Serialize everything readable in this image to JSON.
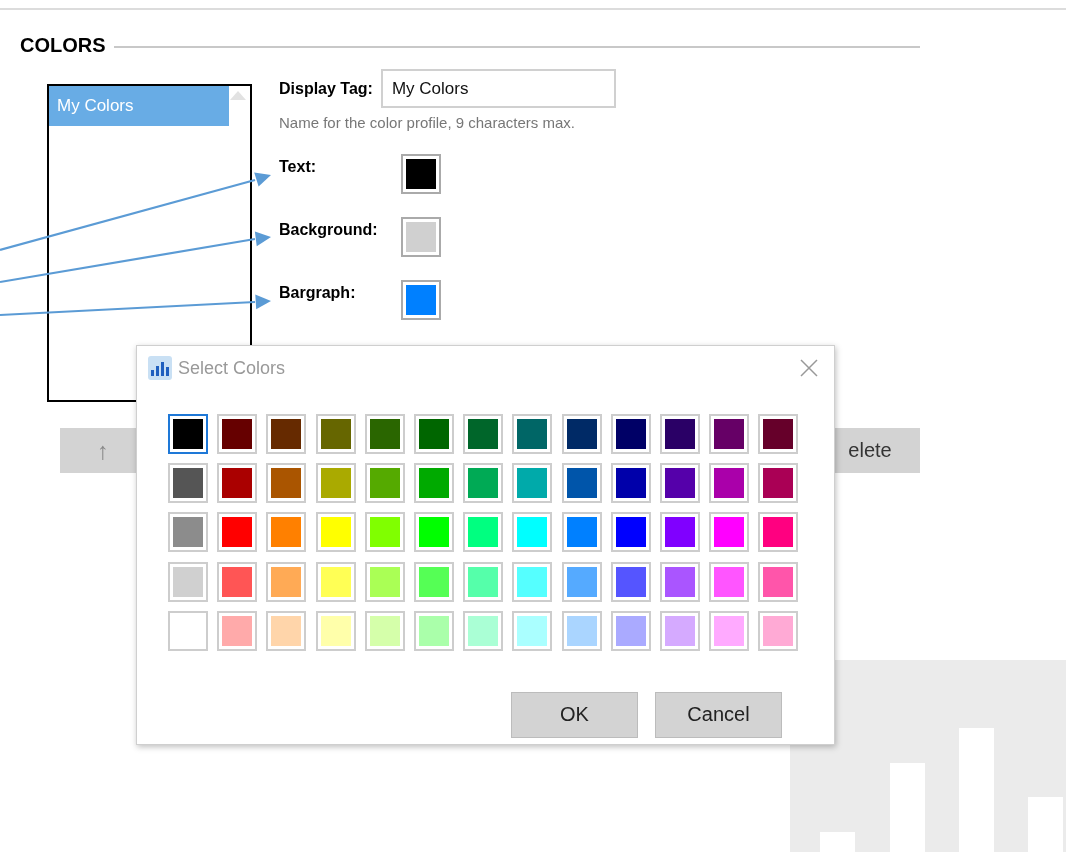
{
  "section": {
    "title": "COLORS"
  },
  "profiles": [
    {
      "label": "My Colors",
      "selected": true
    }
  ],
  "display_tag": {
    "label": "Display Tag:",
    "value": "My Colors",
    "hint": "Name for the color profile, 9 characters max."
  },
  "color_settings": [
    {
      "label": "Text:",
      "color": "#000000",
      "pointed": true
    },
    {
      "label": "Background:",
      "color": "#d0d0d0",
      "pointed": true
    },
    {
      "label": "Bargraph:",
      "color": "#0080ff",
      "pointed": true
    }
  ],
  "list_buttons": [
    {
      "kind": "icon",
      "label": "↑"
    },
    {
      "kind": "text",
      "label": "elete"
    }
  ],
  "dialog": {
    "title": "Select Colors",
    "swatch_rows": [
      [
        {
          "color": "#000000",
          "selected": true
        },
        {
          "color": "#660000",
          "selected": false
        },
        {
          "color": "#662a00",
          "selected": false
        },
        {
          "color": "#666600",
          "selected": false
        },
        {
          "color": "#2a6600",
          "selected": false
        },
        {
          "color": "#006600",
          "selected": false
        },
        {
          "color": "#00662a",
          "selected": false
        },
        {
          "color": "#006666",
          "selected": false
        },
        {
          "color": "#002a66",
          "selected": false
        },
        {
          "color": "#000066",
          "selected": false
        },
        {
          "color": "#2a0066",
          "selected": false
        },
        {
          "color": "#660066",
          "selected": false
        },
        {
          "color": "#66002a",
          "selected": false
        }
      ],
      [
        {
          "color": "#555555",
          "selected": false
        },
        {
          "color": "#aa0000",
          "selected": false
        },
        {
          "color": "#aa5500",
          "selected": false
        },
        {
          "color": "#aaaa00",
          "selected": false
        },
        {
          "color": "#55aa00",
          "selected": false
        },
        {
          "color": "#00aa00",
          "selected": false
        },
        {
          "color": "#00aa55",
          "selected": false
        },
        {
          "color": "#00aaaa",
          "selected": false
        },
        {
          "color": "#0055aa",
          "selected": false
        },
        {
          "color": "#0000aa",
          "selected": false
        },
        {
          "color": "#5500aa",
          "selected": false
        },
        {
          "color": "#aa00aa",
          "selected": false
        },
        {
          "color": "#aa0055",
          "selected": false
        }
      ],
      [
        {
          "color": "#8c8c8c",
          "selected": false
        },
        {
          "color": "#ff0000",
          "selected": false
        },
        {
          "color": "#ff8000",
          "selected": false
        },
        {
          "color": "#ffff00",
          "selected": false
        },
        {
          "color": "#80ff00",
          "selected": false
        },
        {
          "color": "#00ff00",
          "selected": false
        },
        {
          "color": "#00ff80",
          "selected": false
        },
        {
          "color": "#00ffff",
          "selected": false
        },
        {
          "color": "#0080ff",
          "selected": false
        },
        {
          "color": "#0000ff",
          "selected": false
        },
        {
          "color": "#8000ff",
          "selected": false
        },
        {
          "color": "#ff00ff",
          "selected": false
        },
        {
          "color": "#ff0080",
          "selected": false
        }
      ],
      [
        {
          "color": "#d0d0d0",
          "selected": false
        },
        {
          "color": "#ff5555",
          "selected": false
        },
        {
          "color": "#ffaa55",
          "selected": false
        },
        {
          "color": "#ffff55",
          "selected": false
        },
        {
          "color": "#aaff55",
          "selected": false
        },
        {
          "color": "#55ff55",
          "selected": false
        },
        {
          "color": "#55ffaa",
          "selected": false
        },
        {
          "color": "#55ffff",
          "selected": false
        },
        {
          "color": "#55aaff",
          "selected": false
        },
        {
          "color": "#5555ff",
          "selected": false
        },
        {
          "color": "#aa55ff",
          "selected": false
        },
        {
          "color": "#ff55ff",
          "selected": false
        },
        {
          "color": "#ff55aa",
          "selected": false
        }
      ],
      [
        {
          "color": "#ffffff",
          "selected": false
        },
        {
          "color": "#ffaaaa",
          "selected": false
        },
        {
          "color": "#ffd5aa",
          "selected": false
        },
        {
          "color": "#ffffaa",
          "selected": false
        },
        {
          "color": "#d5ffaa",
          "selected": false
        },
        {
          "color": "#aaffaa",
          "selected": false
        },
        {
          "color": "#aaffd5",
          "selected": false
        },
        {
          "color": "#aaffff",
          "selected": false
        },
        {
          "color": "#aad5ff",
          "selected": false
        },
        {
          "color": "#aaaaff",
          "selected": false
        },
        {
          "color": "#d5aaff",
          "selected": false
        },
        {
          "color": "#ffaaff",
          "selected": false
        },
        {
          "color": "#ffaad5",
          "selected": false
        }
      ]
    ],
    "buttons": [
      {
        "label": "OK"
      },
      {
        "label": "Cancel"
      }
    ]
  }
}
